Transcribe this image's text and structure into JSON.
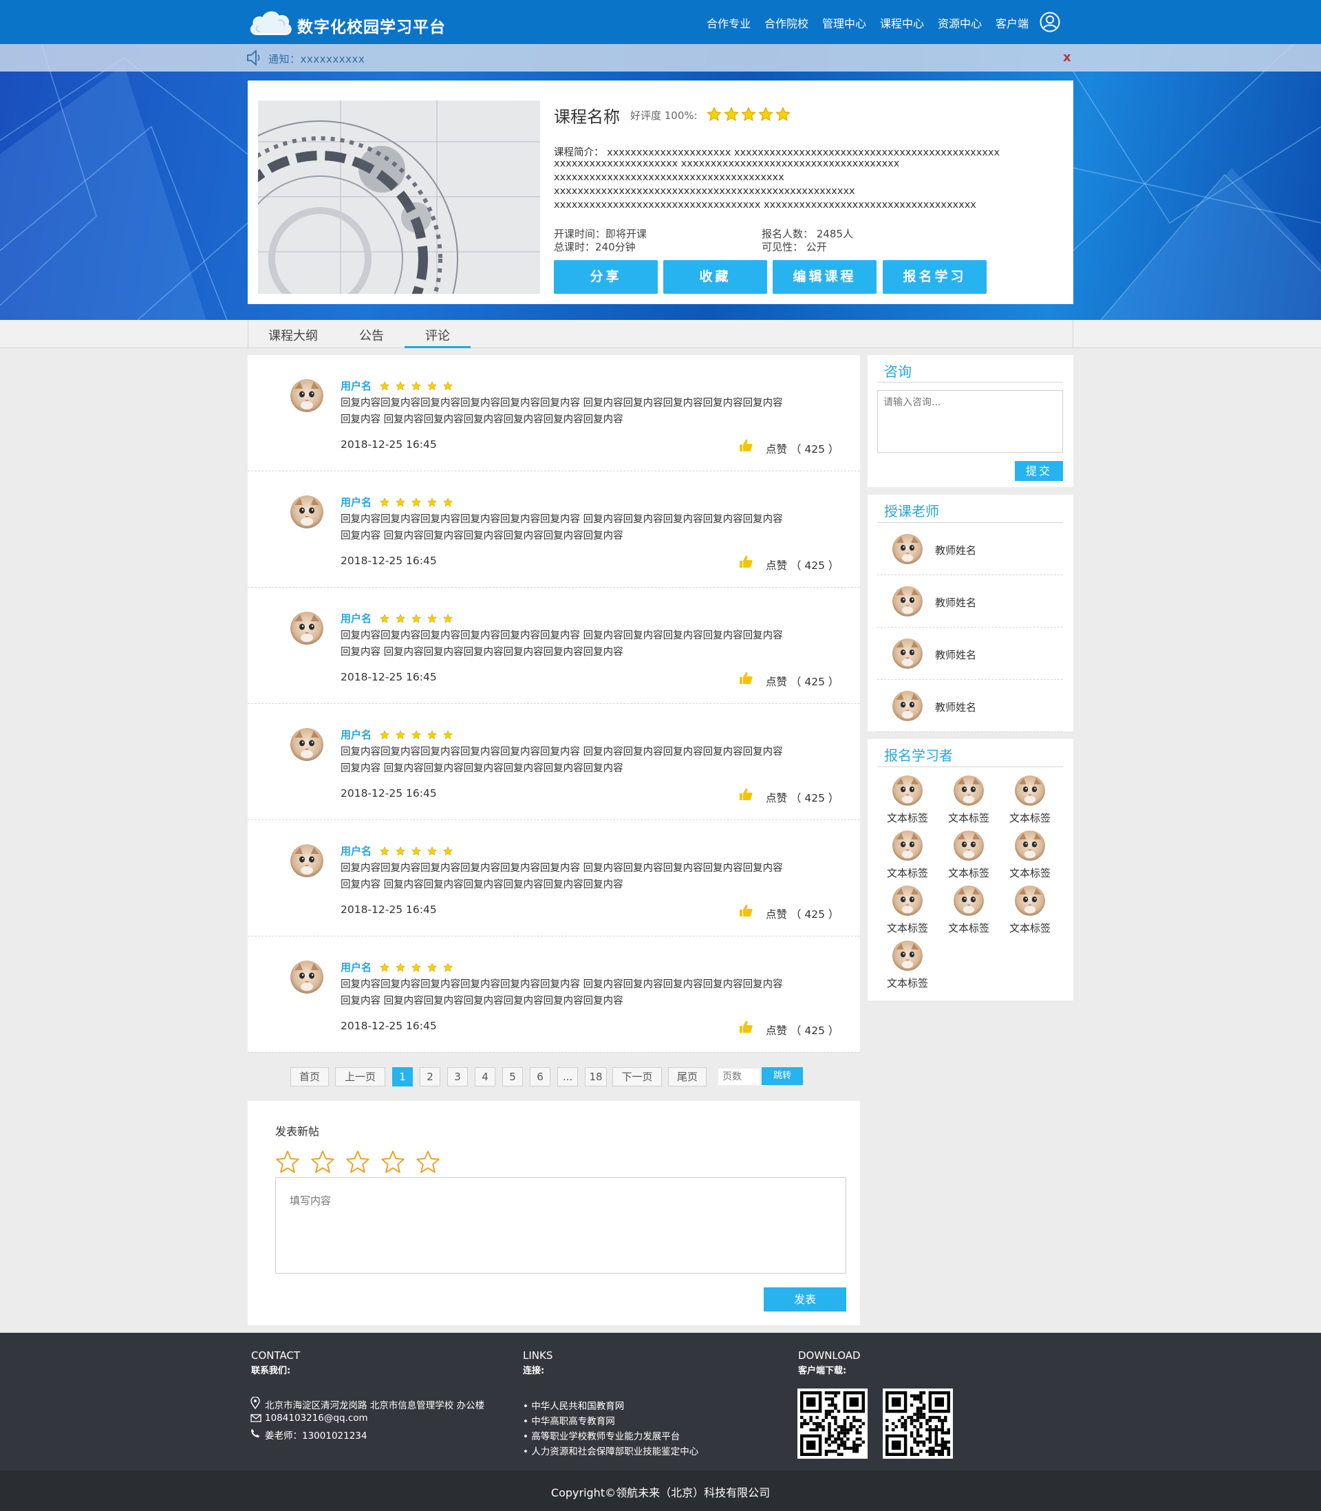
{
  "header": {
    "site_title": "数字化校园学习平台",
    "nav": [
      "合作专业",
      "合作院校",
      "管理中心",
      "课程中心",
      "资源中心",
      "客户端"
    ]
  },
  "notice": {
    "text": "通知：xxxxxxxxxx",
    "close": "x"
  },
  "course": {
    "name": "课程名称",
    "rating_label": "好评度 100%:",
    "rating_stars": 5,
    "intro": [
      "课程简介： xxxxxxxxxxxxxxxxxxxxx xxxxxxxxxxxxxxxxxxxxxxxxxxxxxxxxxxxxxxxxxxxxx",
      "xxxxxxxxxxxxxxxxxxxxx xxxxxxxxxxxxxxxxxxxxxxxxxxxxxxxxxxxxx",
      "xxxxxxxxxxxxxxxxxxxxxxxxxxxxxxxxxxxxxxx",
      "xxxxxxxxxxxxxxxxxxxxxxxxxxxxxxxxxxxxxxxxxxxxxxxxxxx",
      "xxxxxxxxxxxxxxxxxxxxxxxxxxxxxxxxxxx xxxxxxxxxxxxxxxxxxxxxxxxxxxxxxxxxxxx"
    ],
    "start_time": "开课时间：即将开课",
    "total_hours": "总课时：240分钟",
    "enrolled": "报名人数： 2485人",
    "visibility": "可见性： 公开",
    "buttons": [
      "分享",
      "收藏",
      "编辑课程",
      "报名学习"
    ]
  },
  "tabs": [
    "课程大纲",
    "公告",
    "评论"
  ],
  "active_tab": "评论",
  "comments": [
    {
      "user": "用户名",
      "stars": 5,
      "line1": "回复内容回复内容回复内容回复内容回复内容回复内容 回复内容回复内容回复内容回复内容回复内容",
      "line2": "回复内容 回复内容回复内容回复内容回复内容回复内容回复内容",
      "time": "2018-12-25 16:45",
      "like": "点赞 （ 425 ）"
    },
    {
      "user": "用户名",
      "stars": 5,
      "line1": "回复内容回复内容回复内容回复内容回复内容回复内容 回复内容回复内容回复内容回复内容回复内容",
      "line2": "回复内容 回复内容回复内容回复内容回复内容回复内容回复内容",
      "time": "2018-12-25 16:45",
      "like": "点赞 （ 425 ）"
    },
    {
      "user": "用户名",
      "stars": 5,
      "line1": "回复内容回复内容回复内容回复内容回复内容回复内容 回复内容回复内容回复内容回复内容回复内容",
      "line2": "回复内容 回复内容回复内容回复内容回复内容回复内容回复内容",
      "time": "2018-12-25 16:45",
      "like": "点赞 （ 425 ）"
    },
    {
      "user": "用户名",
      "stars": 5,
      "line1": "回复内容回复内容回复内容回复内容回复内容回复内容 回复内容回复内容回复内容回复内容回复内容",
      "line2": "回复内容 回复内容回复内容回复内容回复内容回复内容回复内容",
      "time": "2018-12-25 16:45",
      "like": "点赞 （ 425 ）"
    },
    {
      "user": "用户名",
      "stars": 5,
      "line1": "回复内容回复内容回复内容回复内容回复内容回复内容 回复内容回复内容回复内容回复内容回复内容",
      "line2": "回复内容 回复内容回复内容回复内容回复内容回复内容回复内容",
      "time": "2018-12-25 16:45",
      "like": "点赞 （ 425 ）"
    },
    {
      "user": "用户名",
      "stars": 5,
      "line1": "回复内容回复内容回复内容回复内容回复内容回复内容 回复内容回复内容回复内容回复内容回复内容",
      "line2": "回复内容 回复内容回复内容回复内容回复内容回复内容回复内容",
      "time": "2018-12-25 16:45",
      "like": "点赞 （ 425 ）"
    }
  ],
  "pagination": {
    "first": "首页",
    "prev": "上一页",
    "pages": [
      "1",
      "2",
      "3",
      "4",
      "5",
      "6",
      "...",
      "18"
    ],
    "current": "1",
    "next": "下一页",
    "last": "尾页",
    "page_input_placeholder": "页数",
    "jump": "跳转"
  },
  "new_post": {
    "title": "发表新帖",
    "placeholder": "填写内容",
    "submit": "发表",
    "stars": 5
  },
  "sidebar": {
    "consult": {
      "title": "咨询",
      "placeholder": "请输入咨询...",
      "submit": "提交"
    },
    "teachers": {
      "title": "授课老师",
      "names": [
        "教师姓名",
        "教师姓名",
        "教师姓名",
        "教师姓名"
      ]
    },
    "learners": {
      "title": "报名学习者",
      "names": [
        "文本标签",
        "文本标签",
        "文本标签",
        "文本标签",
        "文本标签",
        "文本标签",
        "文本标签",
        "文本标签",
        "文本标签",
        "文本标签"
      ]
    }
  },
  "footer": {
    "contact": {
      "head": "CONTACT",
      "sub": "联系我们:",
      "address": "北京市海淀区清河龙岗路 北京市信息管理学校 办公楼",
      "email": "1084103216@qq.com",
      "phone": "姜老师：13001021234"
    },
    "links": {
      "head": "LINKS",
      "sub": "连接:",
      "items": [
        "• 中华人民共和国教育网",
        "• 中华高职高专教育网",
        "• 高等职业学校教师专业能力发展平台",
        "• 人力资源和社会保障部职业技能鉴定中心"
      ]
    },
    "download": {
      "head": "DOWNLOAD",
      "sub": "客户端下载:"
    },
    "copyright": "Copyright©领航未来（北京）科技有限公司"
  },
  "colors": {
    "header": "#0a74c9",
    "accent": "#27b3f0",
    "link_blue": "#27a6e0",
    "star": "#f5d300",
    "footer": "#33373d"
  },
  "icons": [
    "cloud-logo-icon",
    "user-circle-icon",
    "speaker-icon",
    "close-icon",
    "star-icon",
    "thumb-up-icon",
    "location-icon",
    "mail-icon",
    "phone-icon",
    "qr-code-icon"
  ]
}
